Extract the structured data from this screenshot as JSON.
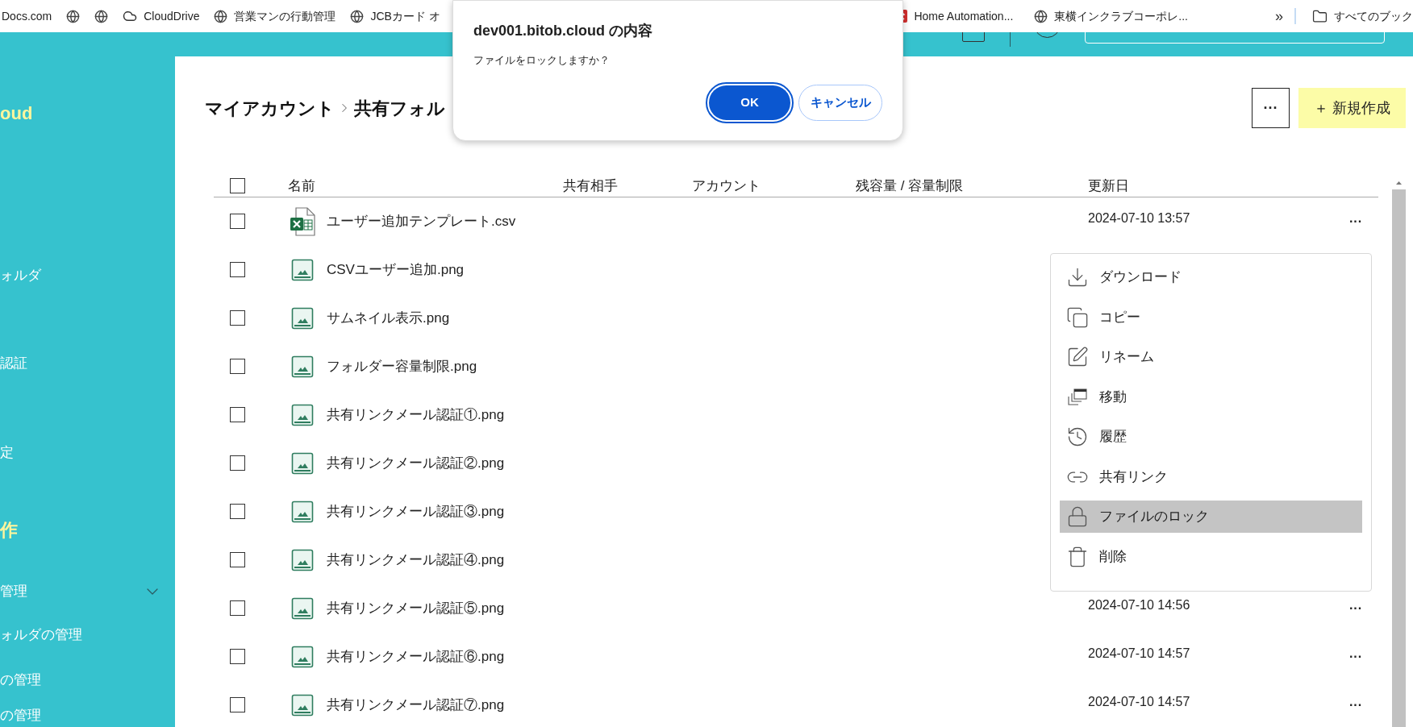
{
  "bookmarks_left": [
    {
      "kind": "none",
      "label": "Docs.com"
    },
    {
      "kind": "globe"
    },
    {
      "kind": "globe"
    },
    {
      "kind": "cloud",
      "label": "CloudDrive"
    },
    {
      "kind": "globe",
      "label": "営業マンの行動管理"
    },
    {
      "kind": "globe",
      "label": "JCBカード オ"
    }
  ],
  "bookmarks_right": [
    {
      "kind": "app",
      "label": "Home Automation..."
    },
    {
      "kind": "globe",
      "label": "東横インクラブコーポレ..."
    }
  ],
  "bookmarks_overflow": "»",
  "bookmarks_folder": "すべてのブック",
  "sidebar": [
    {
      "kind": "brand",
      "text": "oud"
    },
    {
      "kind": "item",
      "text": "ォルダ"
    },
    {
      "kind": "item",
      "text": "認証"
    },
    {
      "kind": "item",
      "text": "定"
    },
    {
      "kind": "heading",
      "text": "作"
    },
    {
      "kind": "group",
      "text": "管理"
    },
    {
      "kind": "item",
      "text": "ォルダの管理"
    },
    {
      "kind": "item",
      "text": "の管理"
    },
    {
      "kind": "item",
      "text": "の管理"
    }
  ],
  "breadcrumb": [
    "マイアカウント",
    "共有フォル"
  ],
  "more_button": "···",
  "new_button": "＋ 新規作成",
  "table": {
    "select_all": {
      "checked": false
    },
    "columns": [
      "名前",
      "共有相手",
      "アカウント",
      "残容量 / 容量制限",
      "更新日"
    ],
    "rows": [
      {
        "checked": false,
        "kind": "excel",
        "name": "ユーザー追加テンプレート.csv",
        "updated": "2024-07-10 13:57"
      },
      {
        "checked": false,
        "kind": "image",
        "name": "CSVユーザー追加.png"
      },
      {
        "checked": false,
        "kind": "image",
        "name": "サムネイル表示.png"
      },
      {
        "checked": false,
        "kind": "image",
        "name": "フォルダー容量制限.png"
      },
      {
        "checked": false,
        "kind": "image",
        "name": "共有リンクメール認証①.png"
      },
      {
        "checked": false,
        "kind": "image",
        "name": "共有リンクメール認証②.png"
      },
      {
        "checked": false,
        "kind": "image",
        "name": "共有リンクメール認証③.png"
      },
      {
        "checked": false,
        "kind": "image",
        "name": "共有リンクメール認証④.png"
      },
      {
        "checked": false,
        "kind": "image",
        "name": "共有リンクメール認証⑤.png",
        "updated": "2024-07-10 14:56"
      },
      {
        "checked": false,
        "kind": "image",
        "name": "共有リンクメール認証⑥.png",
        "updated": "2024-07-10 14:57"
      },
      {
        "checked": false,
        "kind": "image",
        "name": "共有リンクメール認証⑦.png",
        "updated": "2024-07-10 14:57"
      }
    ]
  },
  "context_menu": [
    {
      "kind": "download",
      "label": "ダウンロード",
      "selected": false
    },
    {
      "kind": "copy",
      "label": "コピー",
      "selected": false
    },
    {
      "kind": "rename",
      "label": "リネーム",
      "selected": false
    },
    {
      "kind": "move",
      "label": "移動",
      "selected": false
    },
    {
      "kind": "history",
      "label": "履歴",
      "selected": false
    },
    {
      "kind": "link",
      "label": "共有リンク",
      "selected": false
    },
    {
      "kind": "lock",
      "label": "ファイルのロック",
      "selected": true
    },
    {
      "kind": "trash",
      "label": "削除",
      "selected": false
    }
  ],
  "dialog": {
    "title": "dev001.bitob.cloud の内容",
    "message": "ファイルをロックしますか？",
    "buttons": [
      {
        "kind": "primary",
        "label": "OK"
      },
      {
        "kind": "secondary",
        "label": "キャンセル"
      }
    ]
  }
}
